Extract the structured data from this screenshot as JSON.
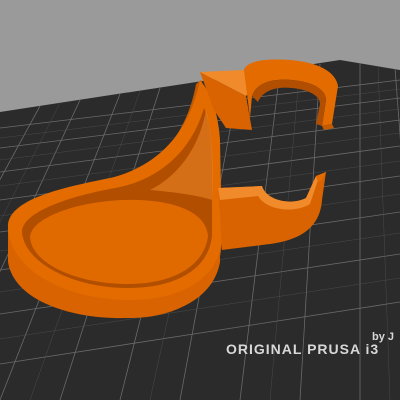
{
  "viewport": {
    "background_color": "#9a9a9a"
  },
  "bed": {
    "brand_text": "ORIGINAL PRUSA i3",
    "byline_text": "by J",
    "surface_color": "#2b2b2b",
    "grid_color": "#6e6e6e"
  },
  "model": {
    "name": "cup-holder-model",
    "color": "#e36b00",
    "shade_color": "#b85000",
    "highlight_color": "#f08a2a"
  }
}
